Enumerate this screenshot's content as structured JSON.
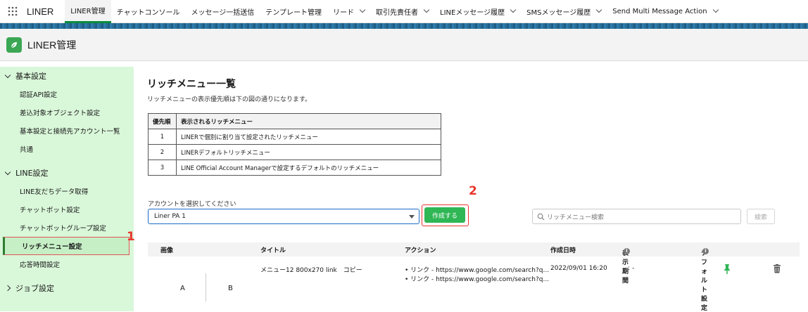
{
  "app": {
    "name": "LINER"
  },
  "nav": {
    "items": [
      {
        "label": "LINER管理",
        "active": true,
        "dropdown": false
      },
      {
        "label": "チャットコンソール",
        "active": false,
        "dropdown": false
      },
      {
        "label": "メッセージ一括送信",
        "active": false,
        "dropdown": false
      },
      {
        "label": "テンプレート管理",
        "active": false,
        "dropdown": false
      },
      {
        "label": "リード",
        "active": false,
        "dropdown": true
      },
      {
        "label": "取引先責任者",
        "active": false,
        "dropdown": true
      },
      {
        "label": "LINEメッセージ履歴",
        "active": false,
        "dropdown": true
      },
      {
        "label": "SMSメッセージ履歴",
        "active": false,
        "dropdown": true
      },
      {
        "label": "Send Multi Message Action",
        "active": false,
        "dropdown": true
      }
    ]
  },
  "header": {
    "title": "LINER管理"
  },
  "sidebar": {
    "sections": [
      {
        "label": "基本設定",
        "expanded": true,
        "items": [
          "認証API設定",
          "差込対象オブジェクト設定",
          "基本設定と接続先アカウント一覧",
          "共通"
        ]
      },
      {
        "label": "LINE設定",
        "expanded": true,
        "items": [
          "LINE友だちデータ取得",
          "チャットボット設定",
          "チャットボットグループ設定",
          "リッチメニュー設定",
          "応答時間設定"
        ]
      },
      {
        "label": "ジョブ設定",
        "expanded": false,
        "items": []
      }
    ],
    "selected": "リッチメニュー設定"
  },
  "main": {
    "title": "リッチメニュー一覧",
    "description": "リッチメニューの表示優先順は下の図の通りになります。",
    "priority_table": {
      "headers": [
        "優先順",
        "表示されるリッチメニュー"
      ],
      "rows": [
        [
          "1",
          "LINERで個別に割り当て設定されたリッチメニュー"
        ],
        [
          "2",
          "LINERデフォルトリッチメニュー"
        ],
        [
          "3",
          "LINE Official Account Managerで設定するデフォルトのリッチメニュー"
        ]
      ]
    },
    "account_label": "アカウントを選択してください",
    "account_value": "Liner PA 1",
    "create_button": "作成する",
    "search_placeholder": "リッチメニュー検索",
    "search_button": "検索",
    "annotations": {
      "one": "1",
      "two": "2"
    },
    "list": {
      "headers": {
        "image": "画像",
        "title": "タイトル",
        "action": "アクション",
        "created": "作成日時",
        "period": "表示期間",
        "default": "デフォルト設定"
      },
      "rows": [
        {
          "image_a": "A",
          "image_b": "B",
          "title": "メニュー12 800x270 link　コピー",
          "actions": [
            "リンク - https://www.google.com/search?q...",
            "リンク - https://www.google.com/search?q..."
          ],
          "created": "2022/09/01 16:20",
          "period": "- : -",
          "default_icon": "pin-icon",
          "delete_icon": "trash-icon"
        }
      ]
    }
  },
  "colors": {
    "accent_green": "#2fb655",
    "annotation_red": "#e8362c",
    "sidebar_bg": "#d9f7d9"
  }
}
